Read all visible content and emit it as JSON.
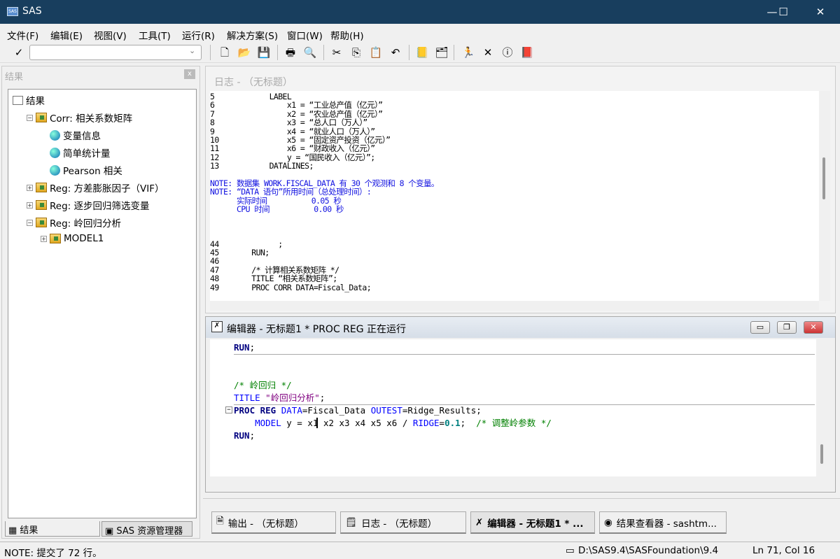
{
  "window": {
    "title": "SAS",
    "minimize": "—",
    "maximize": "☐",
    "close": "✕"
  },
  "menu": [
    "文件(F)",
    "编辑(E)",
    "视图(V)",
    "工具(T)",
    "运行(R)",
    "解决方案(S)",
    "窗口(W)",
    "帮助(H)"
  ],
  "toolbar": {
    "check": "✓",
    "command_value": "",
    "icons": [
      "new-icon",
      "open-icon",
      "save-icon",
      "print-icon",
      "print-preview-icon",
      "cut-icon",
      "copy-icon",
      "paste-icon",
      "undo-icon",
      "explorer-icon",
      "results-icon",
      "submit-icon",
      "clear-icon",
      "help-icon",
      "book-icon"
    ]
  },
  "results_panel": {
    "title": "结果",
    "close": "x",
    "tree": [
      {
        "label": "结果",
        "icon": "book",
        "level": 0,
        "toggle": ""
      },
      {
        "label": "Corr:  相关系数矩阵",
        "icon": "folder",
        "level": 1,
        "toggle": "−"
      },
      {
        "label": "变量信息",
        "icon": "globe",
        "level": 2,
        "toggle": ""
      },
      {
        "label": "简单统计量",
        "icon": "globe",
        "level": 2,
        "toggle": ""
      },
      {
        "label": "Pearson 相关",
        "icon": "globe",
        "level": 2,
        "toggle": ""
      },
      {
        "label": "Reg:  方差膨胀因子（VIF）",
        "icon": "folder",
        "level": 1,
        "toggle": "+"
      },
      {
        "label": "Reg:  逐步回归筛选变量",
        "icon": "folder",
        "level": 1,
        "toggle": "+"
      },
      {
        "label": "Reg:  岭回归分析",
        "icon": "folder",
        "level": 1,
        "toggle": "−"
      },
      {
        "label": "MODEL1",
        "icon": "folder",
        "level": 2,
        "toggle": "+"
      }
    ],
    "tabs": [
      "结果",
      "SAS 资源管理器"
    ]
  },
  "log_window": {
    "title": "日志 -  （无标题）",
    "lines": [
      {
        "n": "5",
        "t": "        LABEL",
        "note": false
      },
      {
        "n": "6",
        "t": "            x1 = “工业总产值（亿元）”",
        "note": false
      },
      {
        "n": "7",
        "t": "            x2 = “农业总产值（亿元）”",
        "note": false
      },
      {
        "n": "8",
        "t": "            x3 = “总人口（万人）”",
        "note": false
      },
      {
        "n": "9",
        "t": "            x4 = “就业人口（万人）”",
        "note": false
      },
      {
        "n": "10",
        "t": "            x5 = “固定资产投资（亿元）”",
        "note": false
      },
      {
        "n": "11",
        "t": "            x6 = “财政收入（亿元）”",
        "note": false
      },
      {
        "n": "12",
        "t": "            y = “国民收入（亿元）”;",
        "note": false
      },
      {
        "n": "13",
        "t": "        DATALINES;",
        "note": false
      },
      {
        "n": "",
        "t": "",
        "note": false
      },
      {
        "n": "",
        "t": "NOTE: 数据集 WORK.FISCAL_DATA 有 30 个观测和 8 个变量。",
        "note": true
      },
      {
        "n": "",
        "t": "NOTE: “DATA 语句”所用时间（总处理时间）:",
        "note": true
      },
      {
        "n": "",
        "t": "      实际时间          0.05 秒",
        "note": true
      },
      {
        "n": "",
        "t": "      CPU 时间          0.00 秒",
        "note": true
      },
      {
        "n": "",
        "t": "",
        "note": false
      },
      {
        "n": "",
        "t": "",
        "note": false
      },
      {
        "n": "",
        "t": "",
        "note": false
      },
      {
        "n": "44",
        "t": "          ;",
        "note": false
      },
      {
        "n": "45",
        "t": "    RUN;",
        "note": false
      },
      {
        "n": "46",
        "t": "",
        "note": false
      },
      {
        "n": "47",
        "t": "    /* 计算相关系数矩阵 */",
        "note": false
      },
      {
        "n": "48",
        "t": "    TITLE “相关系数矩阵”;",
        "note": false
      },
      {
        "n": "49",
        "t": "    PROC CORR DATA=Fiscal_Data;",
        "note": false
      }
    ]
  },
  "editor_window": {
    "title": "编辑器 - 无标题1 *    PROC REG 正在运行",
    "buttons": [
      "▭",
      "❐",
      "✕"
    ],
    "lines": [
      {
        "tokens": [
          {
            "t": "RUN",
            "c": "kw"
          },
          {
            "t": ";",
            "c": ""
          }
        ],
        "rule": true,
        "fold": ""
      },
      {
        "tokens": [],
        "rule": false,
        "fold": ""
      },
      {
        "tokens": [],
        "rule": false,
        "fold": ""
      },
      {
        "tokens": [
          {
            "t": "/* 岭回归 */",
            "c": "cmt"
          }
        ],
        "rule": false,
        "fold": ""
      },
      {
        "tokens": [
          {
            "t": "TITLE",
            "c": "opt"
          },
          {
            "t": " \"岭回归分析\"",
            "c": "str"
          },
          {
            "t": ";",
            "c": ""
          }
        ],
        "rule": true,
        "fold": ""
      },
      {
        "tokens": [
          {
            "t": "PROC REG",
            "c": "kw"
          },
          {
            "t": " DATA",
            "c": "opt"
          },
          {
            "t": "=Fiscal_Data ",
            "c": ""
          },
          {
            "t": "OUTEST",
            "c": "opt"
          },
          {
            "t": "=Ridge_Results;",
            "c": ""
          }
        ],
        "rule": false,
        "fold": "−"
      },
      {
        "tokens": [
          {
            "t": "    MODEL",
            "c": "opt"
          },
          {
            "t": " y = x1 x2 x3 x4 x5 x6 / ",
            "c": ""
          },
          {
            "t": "RIDGE",
            "c": "opt"
          },
          {
            "t": "=",
            "c": ""
          },
          {
            "t": "0.1",
            "c": "num"
          },
          {
            "t": ";  ",
            "c": ""
          },
          {
            "t": "/* 调整岭参数 */",
            "c": "cmt"
          }
        ],
        "rule": false,
        "fold": ""
      },
      {
        "tokens": [
          {
            "t": "RUN",
            "c": "kw"
          },
          {
            "t": ";",
            "c": ""
          }
        ],
        "rule": false,
        "fold": ""
      }
    ]
  },
  "taskbar": [
    {
      "label": "输出 -  （无标题）",
      "icon": "output-icon",
      "active": false
    },
    {
      "label": "日志 -  （无标题）",
      "icon": "log-icon",
      "active": false
    },
    {
      "label": "编辑器 - 无标题1 *    ...",
      "icon": "editor-icon",
      "active": true
    },
    {
      "label": "结果查看器 - sashtm...",
      "icon": "results-viewer-icon",
      "active": false
    }
  ],
  "status": {
    "message": "NOTE: 提交了 72 行。",
    "path": "D:\\SAS9.4\\SASFoundation\\9.4",
    "position": "Ln 71, Col 16"
  }
}
